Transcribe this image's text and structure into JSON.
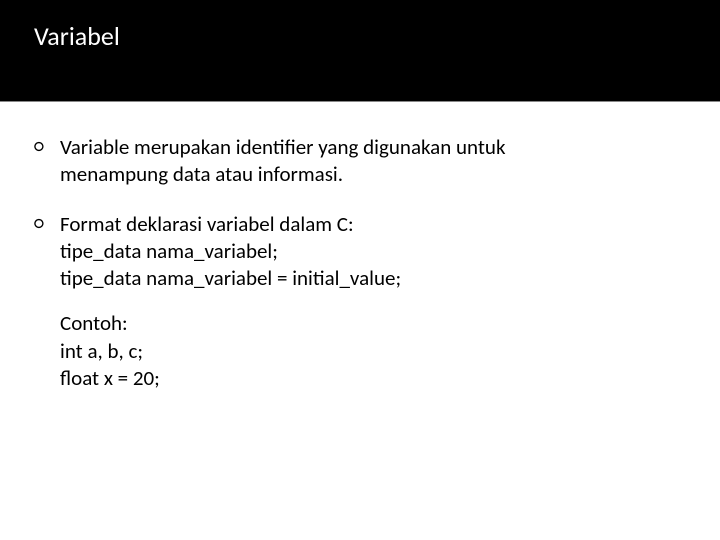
{
  "header": {
    "title": "Variabel"
  },
  "bullets": [
    {
      "line1": "Variable merupakan identifier yang digunakan untuk",
      "line2": "menampung data atau informasi."
    },
    {
      "line1": "Format deklarasi variabel dalam C:",
      "line2": "tipe_data nama_variabel;",
      "line3": "tipe_data nama_variabel = initial_value;",
      "example_label": "Contoh:",
      "example_line1": "int a, b, c;",
      "example_line2": "float x = 20;"
    }
  ]
}
